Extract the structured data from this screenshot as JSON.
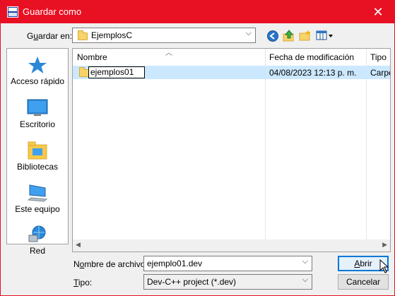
{
  "window": {
    "title": "Guardar como",
    "close_glyph": "✕"
  },
  "location": {
    "label_prefix": "G",
    "label_underlined": "u",
    "label_rest": "ardar en:",
    "value": "EjemplosC"
  },
  "toolbar": {
    "icons": [
      "back-icon",
      "up-folder-icon",
      "new-folder-icon",
      "view-menu-icon"
    ]
  },
  "sidebar": {
    "items": [
      {
        "label": "Acceso rápido",
        "icon": "star-icon"
      },
      {
        "label": "Escritorio",
        "icon": "desktop-icon"
      },
      {
        "label": "Bibliotecas",
        "icon": "libraries-icon"
      },
      {
        "label": "Este equipo",
        "icon": "computer-icon"
      },
      {
        "label": "Red",
        "icon": "network-icon"
      }
    ]
  },
  "filelist": {
    "columns": [
      "Nombre",
      "Fecha de modificación",
      "Tipo"
    ],
    "rows": [
      {
        "name": "ejemplos01",
        "date": "04/08/2023 12:13 p. m.",
        "type": "Carpe"
      }
    ]
  },
  "filename": {
    "label_prefix": "N",
    "label_underlined": "o",
    "label_rest": "mbre de archivo:",
    "value": "ejemplo01.dev"
  },
  "filetype": {
    "label_underlined": "T",
    "label_rest": "ipo:",
    "value": "Dev-C++ project (*.dev)"
  },
  "buttons": {
    "open": {
      "underlined": "A",
      "rest": "brir"
    },
    "cancel": "Cancelar"
  },
  "colors": {
    "titlebar": "#e81123",
    "selection": "#cce8ff",
    "accent": "#0078d7"
  }
}
